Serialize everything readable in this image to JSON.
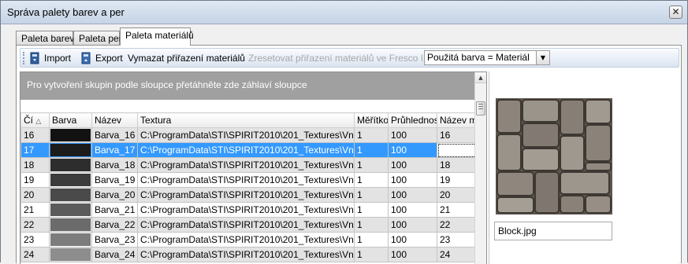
{
  "window": {
    "title": "Správa palety barev a per",
    "close_glyph": "✕"
  },
  "tabs": [
    {
      "label": "Paleta barev",
      "active": false
    },
    {
      "label": "Paleta per",
      "active": false
    },
    {
      "label": "Paleta materiálů",
      "active": true
    }
  ],
  "toolbar": {
    "import_label": "Import",
    "import_icon": "import-icon",
    "export_label": "Export",
    "export_icon": "export-icon",
    "clear_label": "Vymazat přiřazení materiálů",
    "reset_label": "Zresetovat přiřazení materiálů ve Fresco II",
    "reset_disabled": true,
    "combo_value": "Použitá barva = Materiál",
    "combo_arrow": "▼"
  },
  "grid": {
    "group_hint": "Pro vytvoření skupin podle sloupce přetáhněte zde záhlaví sloupce",
    "sort_indicator": "△",
    "columns": [
      "Čí",
      "Barva",
      "Název",
      "Textura",
      "Měřítko",
      "Průhlednost",
      "Název m"
    ],
    "rows": [
      {
        "num": "16",
        "color": "#121212",
        "name": "Barva_16",
        "texture": "C:\\ProgramData\\STI\\SPIRIT2010\\201_Textures\\Vnejsi",
        "scale": "1",
        "opacity": "100",
        "mat": "16"
      },
      {
        "num": "17",
        "color": "#1c1c1c",
        "name": "Barva_17",
        "texture": "C:\\ProgramData\\STI\\SPIRIT2010\\201_Textures\\Vnejsi",
        "scale": "1",
        "opacity": "100",
        "mat": ""
      },
      {
        "num": "18",
        "color": "#2d2d2d",
        "name": "Barva_18",
        "texture": "C:\\ProgramData\\STI\\SPIRIT2010\\201_Textures\\Vnejsi",
        "scale": "1",
        "opacity": "100",
        "mat": "18"
      },
      {
        "num": "19",
        "color": "#3c3c3c",
        "name": "Barva_19",
        "texture": "C:\\ProgramData\\STI\\SPIRIT2010\\201_Textures\\Vnejsi",
        "scale": "1",
        "opacity": "100",
        "mat": "19"
      },
      {
        "num": "20",
        "color": "#4a4a4a",
        "name": "Barva_20",
        "texture": "C:\\ProgramData\\STI\\SPIRIT2010\\201_Textures\\Vnejsi",
        "scale": "1",
        "opacity": "100",
        "mat": "20"
      },
      {
        "num": "21",
        "color": "#5b5b5b",
        "name": "Barva_21",
        "texture": "C:\\ProgramData\\STI\\SPIRIT2010\\201_Textures\\Vnejsi",
        "scale": "1",
        "opacity": "100",
        "mat": "21"
      },
      {
        "num": "22",
        "color": "#6b6b6b",
        "name": "Barva_22",
        "texture": "C:\\ProgramData\\STI\\SPIRIT2010\\201_Textures\\Vnejsi",
        "scale": "1",
        "opacity": "100",
        "mat": "22"
      },
      {
        "num": "23",
        "color": "#7c7c7c",
        "name": "Barva_23",
        "texture": "C:\\ProgramData\\STI\\SPIRIT2010\\201_Textures\\Vnejsi",
        "scale": "1",
        "opacity": "100",
        "mat": "23"
      },
      {
        "num": "24",
        "color": "#8d8d8d",
        "name": "Barva_24",
        "texture": "C:\\ProgramData\\STI\\SPIRIT2010\\201_Textures\\Vnejsi",
        "scale": "1",
        "opacity": "100",
        "mat": "24"
      }
    ],
    "selected_row": "17"
  },
  "preview": {
    "texture_name": "Block.jpg",
    "texture_icon": "paving-stone-texture-image"
  }
}
